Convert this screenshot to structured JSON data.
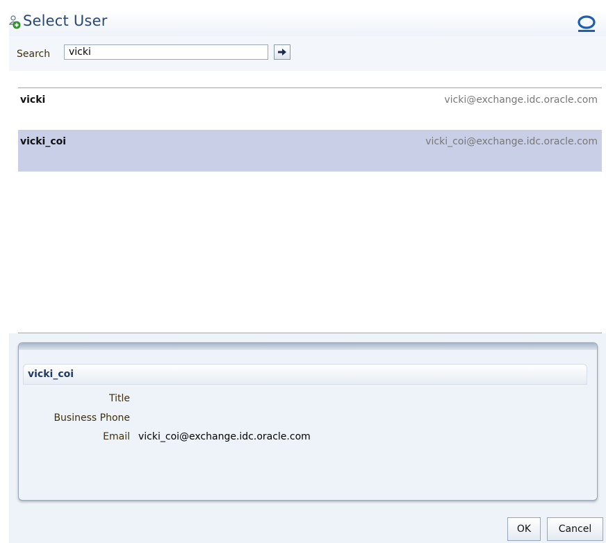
{
  "dialog": {
    "title": "Select User",
    "title_icon": "add-user-icon",
    "logo_icon": "oracle-logo-icon"
  },
  "search": {
    "label": "Search",
    "value": "vicki",
    "button_icon": "arrow-right-icon"
  },
  "results": [
    {
      "name": "vicki",
      "email": "vicki@exchange.idc.oracle.com",
      "selected": false
    },
    {
      "name": "vicki_coi",
      "email": "vicki_coi@exchange.idc.oracle.com",
      "selected": true
    }
  ],
  "detail": {
    "name": "vicki_coi",
    "fields": [
      {
        "label": "Title",
        "value": ""
      },
      {
        "label": "Business Phone",
        "value": ""
      },
      {
        "label": "Email",
        "value": "vicki_coi@exchange.idc.oracle.com"
      }
    ]
  },
  "footer": {
    "ok_label": "OK",
    "cancel_label": "Cancel"
  },
  "colors": {
    "selected_row": "#c8cfe7",
    "title_text": "#2b4870",
    "oracle_red": "#c00000"
  }
}
